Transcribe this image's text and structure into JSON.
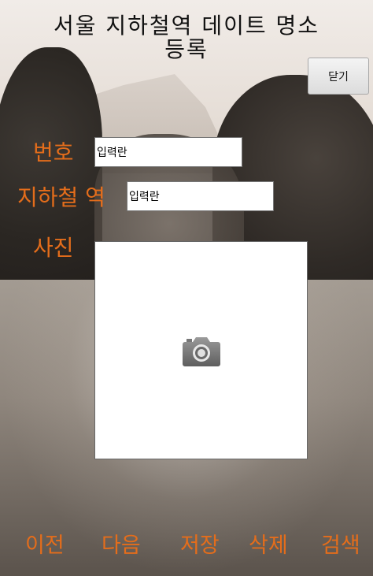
{
  "header": {
    "title_line1": "서울 지하철역 데이트 명소",
    "title_line2": "등록",
    "close_label": "닫기"
  },
  "form": {
    "number_label": "번호",
    "number_value": "입력란",
    "station_label": "지하철 역",
    "station_value": "입력란",
    "photo_label": "사진",
    "photo_icon": "camera-icon"
  },
  "footer": {
    "prev_label": "이전",
    "next_label": "다음",
    "save_label": "저장",
    "delete_label": "삭제",
    "search_label": "검색"
  },
  "colors": {
    "label": "#e46d1b"
  }
}
